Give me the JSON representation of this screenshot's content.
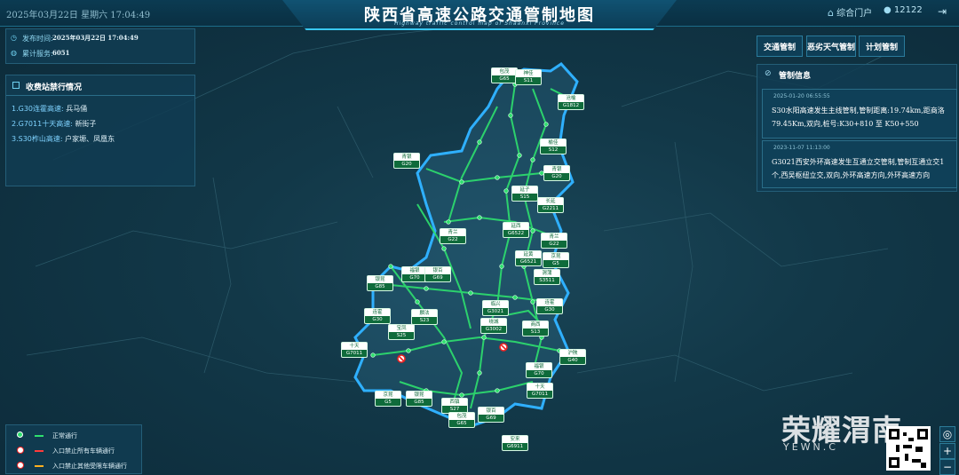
{
  "header": {
    "datetime": "2025年03月22日 星期六  17:04:49",
    "title": "陕西省高速公路交通管制地图",
    "subtitle": "Highway traffic control map of Shaanxi Province",
    "portal_label": "综合门户",
    "user_id": "12122"
  },
  "info": {
    "publish_label": "发布时间:",
    "publish_value": "2025年03月22日  17:04:49",
    "served_label": "累计服务:",
    "served_value": "6051"
  },
  "closures": {
    "heading": "收费站禁行情况",
    "items": [
      {
        "road": "1.G30连霍高速:",
        "place": "兵马俑"
      },
      {
        "road": "2.G7011十天高速:",
        "place": "新街子"
      },
      {
        "road": "3.S30柞山高速:",
        "place": "户家塬、凤凰东"
      }
    ]
  },
  "tabs": [
    "交通管制",
    "恶劣天气管制",
    "计划管制"
  ],
  "control": {
    "heading": "管制信息",
    "notices": [
      {
        "stamp": "2025-01-20 06:55:55",
        "text": "S30水阳高速发生主线管制,管制距离:19.74km,距商洛79.45Km,双向,桩号:K30+810 至 K50+550"
      },
      {
        "stamp": "2023-11-07 11:13:00",
        "text": "G3021西安外环高速发生互通立交管制,管制互通立交1个,西吴枢纽立交,双向,外环高速方向,外环高速方向"
      }
    ]
  },
  "legend": [
    {
      "label": "正常通行",
      "color": "#2ee06e",
      "icon": "node-icon"
    },
    {
      "label": "入口禁止所有车辆通行",
      "color": "#ff3b3b",
      "icon": "no-entry-icon"
    },
    {
      "label": "入口禁止其他受限车辆通行",
      "color": "#ffb020",
      "icon": "no-entry-icon"
    }
  ],
  "route_badges": [
    {
      "a": "包茂",
      "b": "G65"
    },
    {
      "a": "神佳",
      "b": "S11"
    },
    {
      "a": "沧榆",
      "b": "G1812"
    },
    {
      "a": "榆佳",
      "b": "S12"
    },
    {
      "a": "青银",
      "b": "G20"
    },
    {
      "a": "青银",
      "b": "G20"
    },
    {
      "a": "延子",
      "b": "S15"
    },
    {
      "a": "长延",
      "b": "G2211"
    },
    {
      "a": "青兰",
      "b": "G22"
    },
    {
      "a": "延西",
      "b": "G6522"
    },
    {
      "a": "青兰",
      "b": "G22"
    },
    {
      "a": "延黄",
      "b": "G6521"
    },
    {
      "a": "京昆",
      "b": "G5"
    },
    {
      "a": "银昆",
      "b": "G85"
    },
    {
      "a": "福银",
      "b": "G70"
    },
    {
      "a": "银百",
      "b": "G69"
    },
    {
      "a": "渭蒲",
      "b": "S3511"
    },
    {
      "a": "连霍",
      "b": "G30"
    },
    {
      "a": "临兴",
      "b": "G3021"
    },
    {
      "a": "连霍",
      "b": "G30"
    },
    {
      "a": "麟法",
      "b": "S23"
    },
    {
      "a": "宝凤",
      "b": "S25"
    },
    {
      "a": "绕城",
      "b": "G3002"
    },
    {
      "a": "商西",
      "b": "S13"
    },
    {
      "a": "十天",
      "b": "G7011"
    },
    {
      "a": "沪陕",
      "b": "G40"
    },
    {
      "a": "福银",
      "b": "G70"
    },
    {
      "a": "十天",
      "b": "G7011"
    },
    {
      "a": "京昆",
      "b": "G5"
    },
    {
      "a": "银昆",
      "b": "G85"
    },
    {
      "a": "西镇",
      "b": "S27"
    },
    {
      "a": "包茂",
      "b": "G65"
    },
    {
      "a": "银百",
      "b": "G69"
    },
    {
      "a": "安来",
      "b": "G6911"
    }
  ],
  "watermark": {
    "brand": "荣耀渭南",
    "url": "YEWN.C"
  },
  "zoom": {
    "locate": "◎",
    "in": "+",
    "out": "−"
  }
}
